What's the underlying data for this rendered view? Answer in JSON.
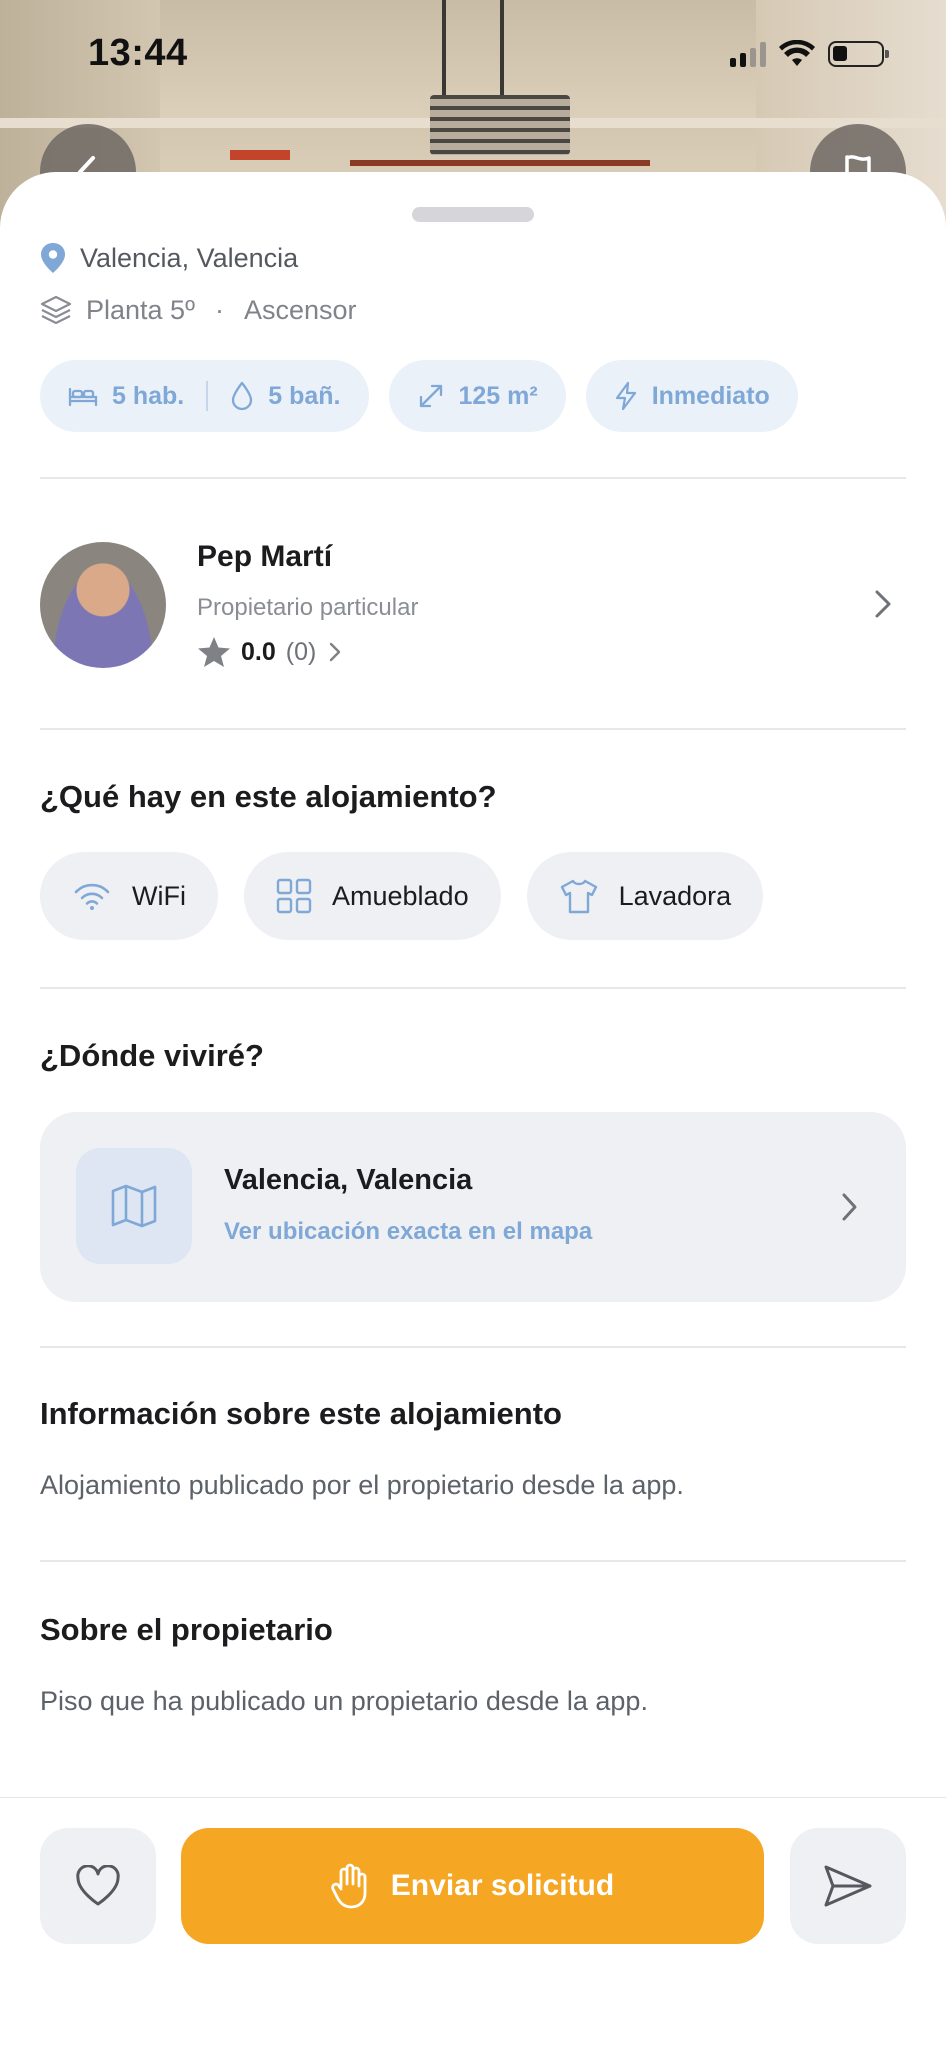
{
  "status_bar": {
    "time": "13:44"
  },
  "listing": {
    "location": "Valencia, Valencia",
    "floor": "Planta 5º",
    "separator": "·",
    "elevator": "Ascensor",
    "chips": {
      "rooms": "5 hab.",
      "baths": "5 bañ.",
      "area": "125 m²",
      "availability": "Inmediato"
    }
  },
  "owner": {
    "name": "Pep Martí",
    "role": "Propietario particular",
    "rating": "0.0",
    "reviews": "(0)"
  },
  "amenities_section": {
    "title": "¿Qué hay en este alojamiento?",
    "items": [
      "WiFi",
      "Amueblado",
      "Lavadora"
    ]
  },
  "location_section": {
    "title": "¿Dónde viviré?",
    "place": "Valencia, Valencia",
    "link": "Ver ubicación exacta en el mapa"
  },
  "info_section": {
    "title": "Información sobre este alojamiento",
    "text": "Alojamiento publicado por el propietario desde la app."
  },
  "owner_section": {
    "title": "Sobre el propietario",
    "text": "Piso que ha publicado un propietario desde la app."
  },
  "actions": {
    "request_label": "Enviar solicitud"
  },
  "colors": {
    "accent_blue": "#7fa8d6",
    "cta_orange": "#f5a623",
    "chip_bg": "#eaf1f9"
  }
}
